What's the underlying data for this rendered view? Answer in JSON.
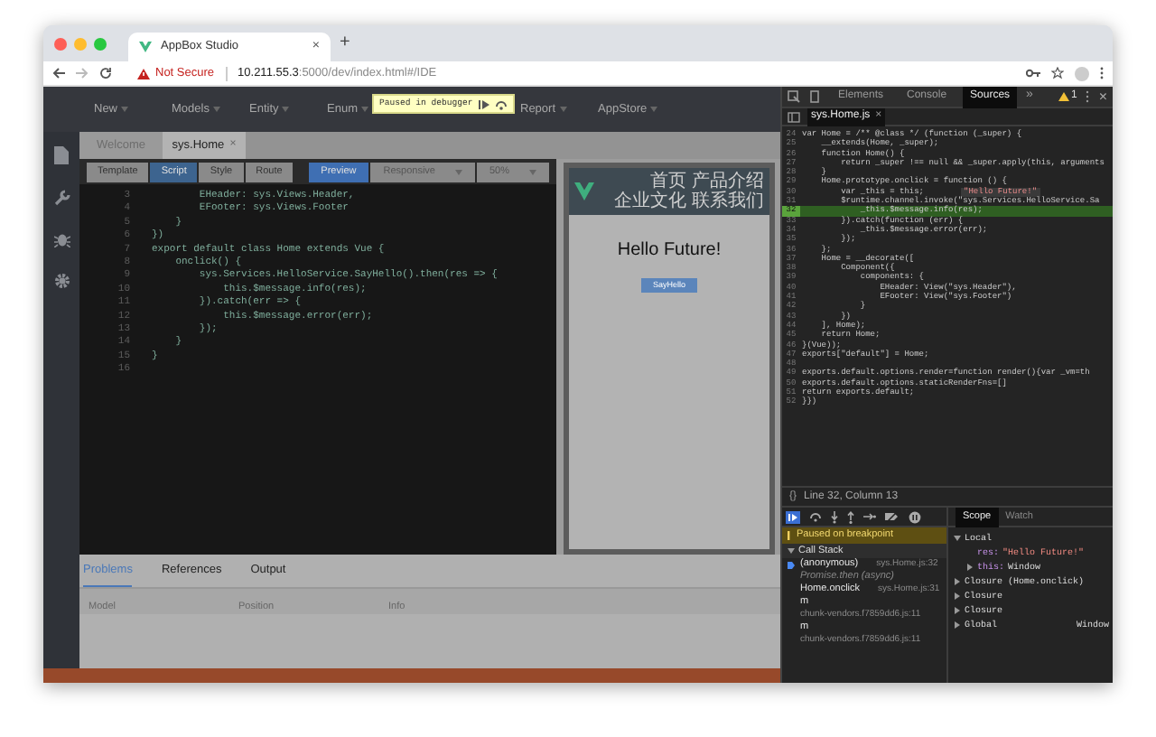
{
  "browser": {
    "tab_title": "AppBox Studio",
    "tab_close": "×",
    "new_tab": "+",
    "security": "Not Secure",
    "url_host": "10.211.55.3",
    "url_rest": ":5000/dev/index.html#/IDE"
  },
  "nav": {
    "items": [
      "New",
      "Models",
      "Entity",
      "Enum",
      "Report",
      "AppStore"
    ]
  },
  "debug_badge": {
    "text": "Paused in debugger"
  },
  "editor_tabs": [
    {
      "label": "Welcome",
      "selected": false
    },
    {
      "label": "sys.Home",
      "selected": true,
      "close": "×"
    }
  ],
  "view_buttons": [
    {
      "label": "Template",
      "selected": false
    },
    {
      "label": "Script",
      "selected": true
    },
    {
      "label": "Style",
      "selected": false
    },
    {
      "label": "Route",
      "selected": false
    }
  ],
  "preview_buttons": [
    {
      "label": "Preview",
      "selected": true,
      "dropdown": false
    },
    {
      "label": "Responsive",
      "selected": false,
      "dropdown": true
    },
    {
      "label": "50%",
      "selected": false,
      "dropdown": true
    }
  ],
  "code_lines": [
    {
      "number": "3",
      "text": "        EHeader: sys.Views.Header,"
    },
    {
      "number": "4",
      "text": "        EFooter: sys.Views.Footer"
    },
    {
      "number": "5",
      "text": "    }"
    },
    {
      "number": "6",
      "text": "})"
    },
    {
      "number": "7",
      "text": "export default class Home extends Vue {"
    },
    {
      "number": "8",
      "text": "    onclick() {"
    },
    {
      "number": "9",
      "text": "        sys.Services.HelloService.SayHello().then(res => {"
    },
    {
      "number": "10",
      "text": "            this.$message.info(res);"
    },
    {
      "number": "11",
      "text": "        }).catch(err => {"
    },
    {
      "number": "12",
      "text": "            this.$message.error(err);"
    },
    {
      "number": "13",
      "text": "        });"
    },
    {
      "number": "14",
      "text": "    }"
    },
    {
      "number": "15",
      "text": "}"
    },
    {
      "number": "16"
    }
  ],
  "preview": {
    "nav": [
      "首页",
      "产品介绍",
      "企业文化",
      "联系我们"
    ],
    "heading": "Hello Future!",
    "button": "SayHello"
  },
  "bottom_panel": {
    "tabs": [
      {
        "label": "Problems",
        "selected": true
      },
      {
        "label": "References",
        "selected": false
      },
      {
        "label": "Output",
        "selected": false
      }
    ],
    "columns": [
      "Model",
      "Position",
      "Info"
    ]
  },
  "devtools": {
    "tabs": [
      {
        "label": "Elements",
        "selected": false
      },
      {
        "label": "Console",
        "selected": false
      },
      {
        "label": "Sources",
        "selected": true
      }
    ],
    "more": "»",
    "warnings": "1",
    "close": "×",
    "file_tab": "sys.Home.js",
    "file_close": "×",
    "lines": [
      {
        "number": "24",
        "text": "var Home = /** @class */ (function (_super) {",
        "current": false
      },
      {
        "number": "25",
        "text": "    __extends(Home, _super);",
        "current": false
      },
      {
        "number": "26",
        "text": "    function Home() {",
        "current": false
      },
      {
        "number": "27",
        "text": "        return _super !== null && _super.apply(this, arguments",
        "current": false
      },
      {
        "number": "28",
        "text": "    }",
        "current": false
      },
      {
        "number": "29",
        "text": "    Home.prototype.onclick = function () {",
        "current": false
      },
      {
        "number": "30",
        "text": "        var _this = this;",
        "current": false,
        "inline_value": "\"Hello Future!\""
      },
      {
        "number": "31",
        "text": "        $runtime.channel.invoke(\"sys.Services.HelloService.Sa",
        "current": false
      },
      {
        "number": "32",
        "text": "            _this.$message.info(res);",
        "current": true
      },
      {
        "number": "33",
        "text": "        }).catch(function (err) {",
        "current": false
      },
      {
        "number": "34",
        "text": "            _this.$message.error(err);",
        "current": false
      },
      {
        "number": "35",
        "text": "        });",
        "current": false
      },
      {
        "number": "36",
        "text": "    };",
        "current": false
      },
      {
        "number": "37",
        "text": "    Home = __decorate([",
        "current": false
      },
      {
        "number": "38",
        "text": "        Component({",
        "current": false
      },
      {
        "number": "39",
        "text": "            components: {",
        "current": false
      },
      {
        "number": "40",
        "text": "                EHeader: View(\"sys.Header\"),",
        "current": false
      },
      {
        "number": "41",
        "text": "                EFooter: View(\"sys.Footer\")",
        "current": false
      },
      {
        "number": "42",
        "text": "            }",
        "current": false
      },
      {
        "number": "43",
        "text": "        })",
        "current": false
      },
      {
        "number": "44",
        "text": "    ], Home);",
        "current": false
      },
      {
        "number": "45",
        "text": "    return Home;",
        "current": false
      },
      {
        "number": "46",
        "text": "}(Vue));",
        "current": false
      },
      {
        "number": "47",
        "text": "exports[\"default\"] = Home;",
        "current": false
      },
      {
        "number": "48",
        "current": false
      },
      {
        "number": "49",
        "text": "exports.default.options.render=function render(){var _vm=th",
        "current": false
      },
      {
        "number": "50",
        "text": "exports.default.options.staticRenderFns=[]",
        "current": false
      },
      {
        "number": "51",
        "text": "return exports.default;",
        "current": false
      },
      {
        "number": "52",
        "text": "}})",
        "current": false
      }
    ],
    "format": "{}",
    "status": "Line 32, Column 13",
    "paused_banner": "Paused on breakpoint",
    "call_stack": {
      "title": "Call Stack",
      "expanded": true,
      "frames": [
        {
          "name": "(anonymous)",
          "location": "sys.Home.js:32",
          "selected": true
        },
        {
          "name": "Promise.then (async)",
          "selected": false
        },
        {
          "name": "Home.onclick",
          "location": "sys.Home.js:31",
          "selected": false
        },
        {
          "name": "m",
          "location": "chunk-vendors.f7859dd6.js:11",
          "selected": false
        },
        {
          "name": "m",
          "location": "chunk-vendors.f7859dd6.js:11",
          "selected": false
        }
      ]
    },
    "scope_tabs": [
      {
        "label": "Scope",
        "selected": true
      },
      {
        "label": "Watch",
        "selected": false
      }
    ],
    "scope": [
      {
        "label": "Local",
        "expanded": true,
        "children": [
          {
            "label": "res:",
            "value": "\"Hello Future!\""
          },
          {
            "label": "this:",
            "value": "Window",
            "expanded": false
          }
        ]
      },
      {
        "label": "Closure (Home.onclick)",
        "expanded": false
      },
      {
        "label": "Closure",
        "expanded": false
      },
      {
        "label": "Closure",
        "expanded": false
      },
      {
        "label": "Global",
        "value": "Window",
        "expanded": false
      }
    ]
  }
}
